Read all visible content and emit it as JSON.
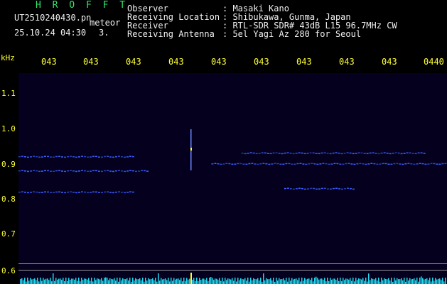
{
  "header": {
    "station": "H R O F F T",
    "filename": "UT2510240430.pn",
    "mode": "meteor",
    "datetime": "25.10.24 04:30",
    "count": "3.",
    "info_labels": [
      "Observer",
      "Receiving Location",
      "Receiver",
      "Receiving Antenna"
    ],
    "info_values": [
      ": Masaki Kano",
      ": Shibukawa, Gunma, Japan",
      ": RTL-SDR SDR# 43dB L15 96.7MHz CW",
      ": 5el Yagi Az 280 for Seoul"
    ]
  },
  "axis": {
    "y_unit": "kHz",
    "x_ticks": [
      "043",
      "043",
      "043",
      "043",
      "043",
      "043",
      "043",
      "043",
      "043",
      "0440"
    ],
    "y_ticks": [
      "1.1",
      "1.0",
      "0.9",
      "0.8",
      "0.7",
      "0.6"
    ]
  },
  "colors": {
    "background": "#000000",
    "plot": "#04001d",
    "signal": "#3a5cff",
    "accent": "#ffff33",
    "station": "#2fe86a"
  },
  "chart_data": {
    "type": "heatmap",
    "xlabel": "",
    "ylabel": "kHz",
    "y_range": [
      0.6,
      1.15
    ],
    "x_ticks": [
      "043",
      "043",
      "043",
      "043",
      "043",
      "043",
      "043",
      "043",
      "043",
      "0440"
    ],
    "traces": [
      {
        "freq": 0.92,
        "t_start": 0.0,
        "t_end": 0.27
      },
      {
        "freq": 0.88,
        "t_start": 0.0,
        "t_end": 0.3
      },
      {
        "freq": 0.82,
        "t_start": 0.0,
        "t_end": 0.27
      },
      {
        "freq": 0.93,
        "t_start": 0.52,
        "t_end": 0.95
      },
      {
        "freq": 0.9,
        "t_start": 0.45,
        "t_end": 1.0
      },
      {
        "freq": 0.83,
        "t_start": 0.62,
        "t_end": 0.78
      }
    ]
  }
}
